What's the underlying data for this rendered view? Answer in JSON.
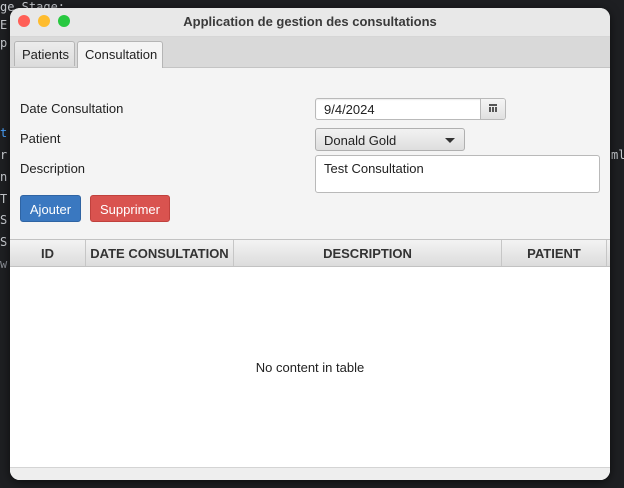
{
  "background_code": {
    "lines": [
      "ge.Stage;",
      "E",
      "p",
      "t",
      "r",
      "n",
      "T",
      "S",
      "S",
      "w",
      "ml"
    ]
  },
  "window": {
    "title": "Application de gestion des consultations"
  },
  "tabs": [
    {
      "label": "Patients",
      "active": false
    },
    {
      "label": "Consultation",
      "active": true
    }
  ],
  "form": {
    "date_label": "Date Consultation",
    "date_value": "9/4/2024",
    "patient_label": "Patient",
    "patient_selected": "Donald Gold",
    "description_label": "Description",
    "description_value": "Test Consultation"
  },
  "buttons": {
    "add": "Ajouter",
    "delete": "Supprimer"
  },
  "table": {
    "columns": [
      "ID",
      "DATE CONSULTATION",
      "DESCRIPTION",
      "PATIENT"
    ],
    "rows": [],
    "empty_text": "No content in table"
  },
  "colors": {
    "add_button": "#3a78c0",
    "delete_button": "#d9534f"
  }
}
